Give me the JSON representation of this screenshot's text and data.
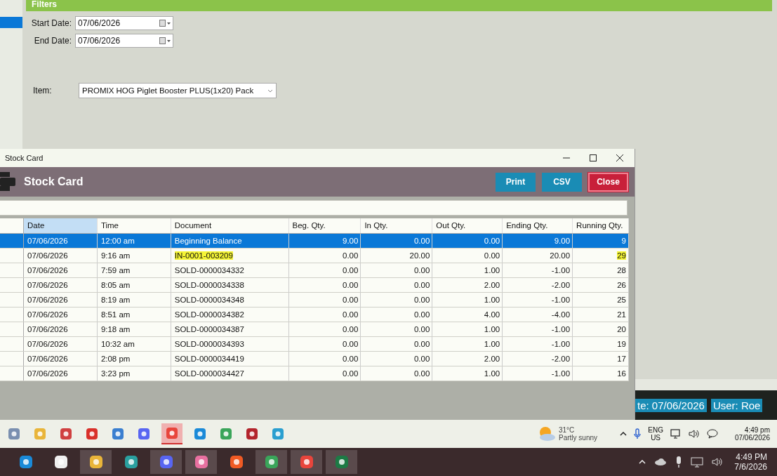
{
  "filters": {
    "title": "Filters",
    "start_date": {
      "label": "Start Date:",
      "value": "07/06/2026"
    },
    "end_date": {
      "label": "End Date:",
      "value": "07/06/2026"
    },
    "item": {
      "label": "Item:",
      "value": "PROMIX HOG Piglet Booster PLUS(1x20) Pack"
    }
  },
  "stock_window": {
    "title": "Stock Card",
    "heading": "Stock Card",
    "buttons": [
      {
        "label": "Print",
        "kind": "primary"
      },
      {
        "label": "CSV",
        "kind": "primary"
      },
      {
        "label": "Close",
        "kind": "danger"
      }
    ],
    "table": {
      "columns": [
        {
          "label": "Date",
          "kind": "text",
          "selected": true
        },
        {
          "label": "Time",
          "kind": "text",
          "selected": false
        },
        {
          "label": "Document",
          "kind": "text",
          "selected": false
        },
        {
          "label": "Beg. Qty.",
          "kind": "number",
          "selected": false
        },
        {
          "label": "In Qty.",
          "kind": "number",
          "selected": false
        },
        {
          "label": "Out Qty.",
          "kind": "number",
          "selected": false
        },
        {
          "label": "Ending Qty.",
          "kind": "number",
          "selected": false
        },
        {
          "label": "Running Qty.",
          "kind": "number",
          "selected": false
        }
      ],
      "rows": [
        {
          "selected": true,
          "cells": [
            {
              "text": "07/06/2026",
              "highlighted": false
            },
            {
              "text": "12:00 am",
              "highlighted": false
            },
            {
              "text": "Beginning Balance",
              "highlighted": false
            },
            {
              "text": "9.00",
              "highlighted": false
            },
            {
              "text": "0.00",
              "highlighted": false
            },
            {
              "text": "0.00",
              "highlighted": false
            },
            {
              "text": "9.00",
              "highlighted": false
            },
            {
              "text": "9",
              "highlighted": false
            }
          ]
        },
        {
          "selected": false,
          "cells": [
            {
              "text": "07/06/2026",
              "highlighted": false
            },
            {
              "text": "9:16 am",
              "highlighted": false
            },
            {
              "text": "IN-0001-003209",
              "highlighted": true
            },
            {
              "text": "0.00",
              "highlighted": false
            },
            {
              "text": "20.00",
              "highlighted": false
            },
            {
              "text": "0.00",
              "highlighted": false
            },
            {
              "text": "20.00",
              "highlighted": false
            },
            {
              "text": "29",
              "highlighted": true
            }
          ]
        },
        {
          "selected": false,
          "cells": [
            {
              "text": "07/06/2026",
              "highlighted": false
            },
            {
              "text": "7:59 am",
              "highlighted": false
            },
            {
              "text": "SOLD-0000034332",
              "highlighted": false
            },
            {
              "text": "0.00",
              "highlighted": false
            },
            {
              "text": "0.00",
              "highlighted": false
            },
            {
              "text": "1.00",
              "highlighted": false
            },
            {
              "text": "-1.00",
              "highlighted": false
            },
            {
              "text": "28",
              "highlighted": false
            }
          ]
        },
        {
          "selected": false,
          "cells": [
            {
              "text": "07/06/2026",
              "highlighted": false
            },
            {
              "text": "8:05 am",
              "highlighted": false
            },
            {
              "text": "SOLD-0000034338",
              "highlighted": false
            },
            {
              "text": "0.00",
              "highlighted": false
            },
            {
              "text": "0.00",
              "highlighted": false
            },
            {
              "text": "2.00",
              "highlighted": false
            },
            {
              "text": "-2.00",
              "highlighted": false
            },
            {
              "text": "26",
              "highlighted": false
            }
          ]
        },
        {
          "selected": false,
          "cells": [
            {
              "text": "07/06/2026",
              "highlighted": false
            },
            {
              "text": "8:19 am",
              "highlighted": false
            },
            {
              "text": "SOLD-0000034348",
              "highlighted": false
            },
            {
              "text": "0.00",
              "highlighted": false
            },
            {
              "text": "0.00",
              "highlighted": false
            },
            {
              "text": "1.00",
              "highlighted": false
            },
            {
              "text": "-1.00",
              "highlighted": false
            },
            {
              "text": "25",
              "highlighted": false
            }
          ]
        },
        {
          "selected": false,
          "cells": [
            {
              "text": "07/06/2026",
              "highlighted": false
            },
            {
              "text": "8:51 am",
              "highlighted": false
            },
            {
              "text": "SOLD-0000034382",
              "highlighted": false
            },
            {
              "text": "0.00",
              "highlighted": false
            },
            {
              "text": "0.00",
              "highlighted": false
            },
            {
              "text": "4.00",
              "highlighted": false
            },
            {
              "text": "-4.00",
              "highlighted": false
            },
            {
              "text": "21",
              "highlighted": false
            }
          ]
        },
        {
          "selected": false,
          "cells": [
            {
              "text": "07/06/2026",
              "highlighted": false
            },
            {
              "text": "9:18 am",
              "highlighted": false
            },
            {
              "text": "SOLD-0000034387",
              "highlighted": false
            },
            {
              "text": "0.00",
              "highlighted": false
            },
            {
              "text": "0.00",
              "highlighted": false
            },
            {
              "text": "1.00",
              "highlighted": false
            },
            {
              "text": "-1.00",
              "highlighted": false
            },
            {
              "text": "20",
              "highlighted": false
            }
          ]
        },
        {
          "selected": false,
          "cells": [
            {
              "text": "07/06/2026",
              "highlighted": false
            },
            {
              "text": "10:32 am",
              "highlighted": false
            },
            {
              "text": "SOLD-0000034393",
              "highlighted": false
            },
            {
              "text": "0.00",
              "highlighted": false
            },
            {
              "text": "0.00",
              "highlighted": false
            },
            {
              "text": "1.00",
              "highlighted": false
            },
            {
              "text": "-1.00",
              "highlighted": false
            },
            {
              "text": "19",
              "highlighted": false
            }
          ]
        },
        {
          "selected": false,
          "cells": [
            {
              "text": "07/06/2026",
              "highlighted": false
            },
            {
              "text": "2:08 pm",
              "highlighted": false
            },
            {
              "text": "SOLD-0000034419",
              "highlighted": false
            },
            {
              "text": "0.00",
              "highlighted": false
            },
            {
              "text": "0.00",
              "highlighted": false
            },
            {
              "text": "2.00",
              "highlighted": false
            },
            {
              "text": "-2.00",
              "highlighted": false
            },
            {
              "text": "17",
              "highlighted": false
            }
          ]
        },
        {
          "selected": false,
          "cells": [
            {
              "text": "07/06/2026",
              "highlighted": false
            },
            {
              "text": "3:23 pm",
              "highlighted": false
            },
            {
              "text": "SOLD-0000034427",
              "highlighted": false
            },
            {
              "text": "0.00",
              "highlighted": false
            },
            {
              "text": "0.00",
              "highlighted": false
            },
            {
              "text": "1.00",
              "highlighted": false
            },
            {
              "text": "-1.00",
              "highlighted": false
            },
            {
              "text": "16",
              "highlighted": false
            }
          ]
        }
      ]
    }
  },
  "status_bar": {
    "date": "te: 07/06/2026",
    "user": "User: Roe"
  },
  "remote_taskbar": {
    "weather": {
      "temperature": "31°C",
      "condition": "Partly sunny"
    },
    "language": "ENG",
    "region": "US",
    "time": "4:49 pm",
    "date": "07/06/2026"
  },
  "taskbar": {
    "time": "4:49 PM",
    "date": "7/6/2026"
  }
}
